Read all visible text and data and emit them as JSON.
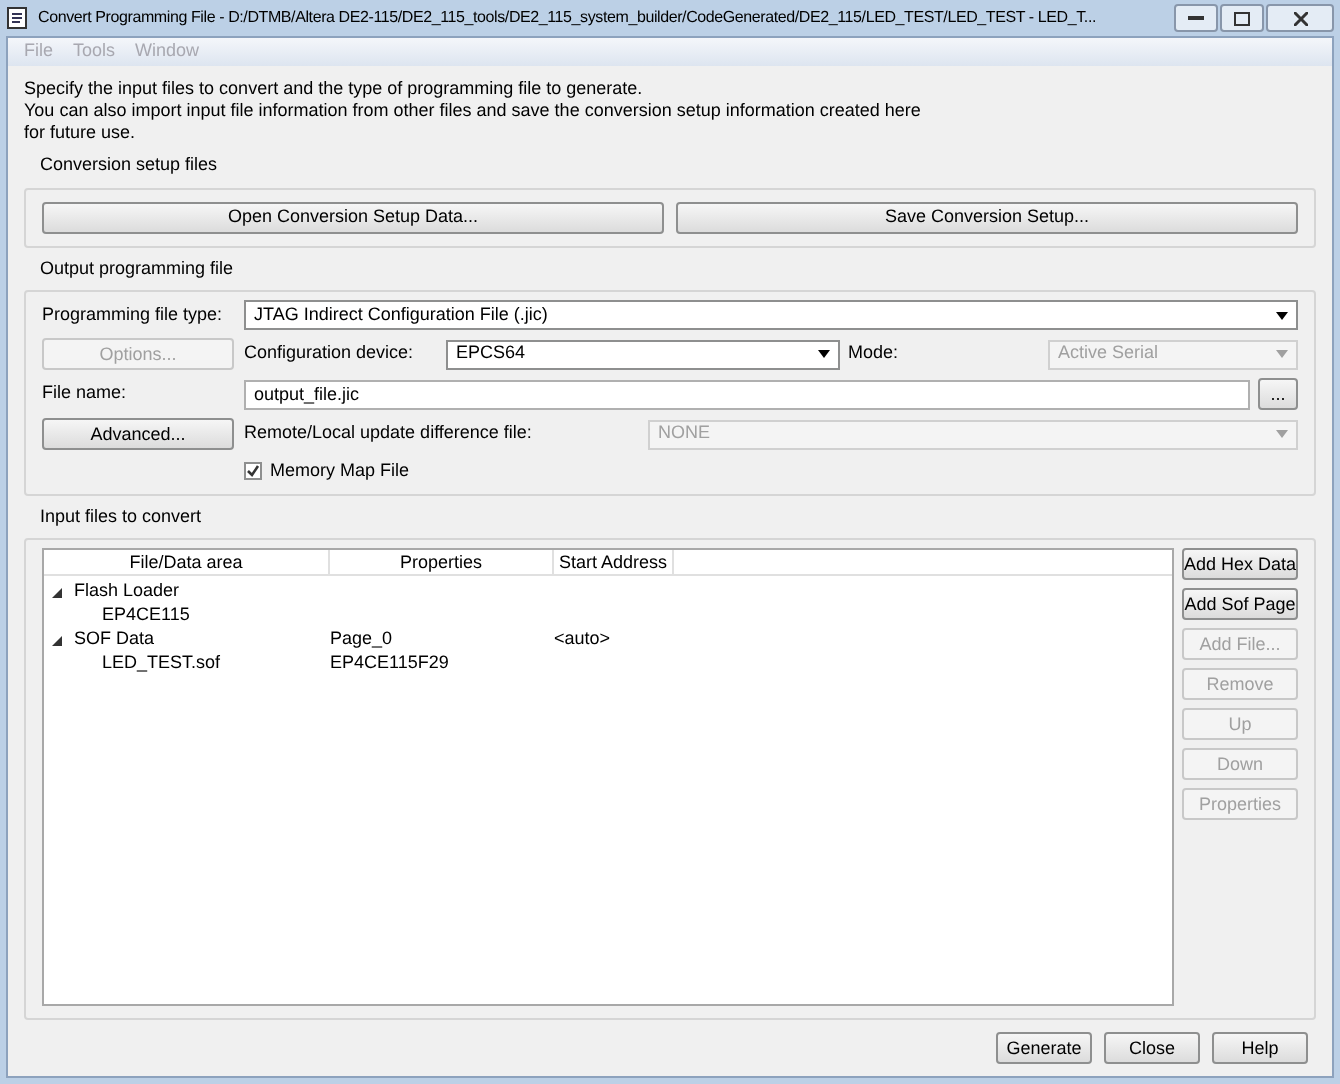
{
  "window": {
    "title": "Convert Programming File - D:/DTMB/Altera DE2-115/DE2_115_tools/DE2_115_system_builder/CodeGenerated/DE2_115/LED_TEST/LED_TEST - LED_T..."
  },
  "menu": [
    {
      "label": "File",
      "disabled": true
    },
    {
      "label": "Tools",
      "disabled": true
    },
    {
      "label": "Window",
      "disabled": true
    }
  ],
  "intro": [
    "Specify the input files to convert and the type of programming file to generate.",
    "You can also import input file information from other files and save the conversion setup information created here for future use."
  ],
  "conversion_setup": {
    "title": "Conversion setup files",
    "buttons": [
      "Open Conversion Setup Data...",
      "Save Conversion Setup..."
    ]
  },
  "output": {
    "title": "Output programming file",
    "file_type": {
      "label": "Programming file type:",
      "value": "JTAG Indirect Configuration File (.jic)"
    },
    "options_button": {
      "label": "Options...",
      "disabled": true
    },
    "device": {
      "label": "Configuration device:",
      "value": "EPCS64"
    },
    "mode": {
      "label": "Mode:",
      "value": "Active Serial",
      "disabled": true
    },
    "file_name": {
      "label": "File name:",
      "value": "output_file.jic",
      "browse": "..."
    },
    "advanced_button": {
      "label": "Advanced...",
      "disabled": false
    },
    "remote": {
      "label": "Remote/Local update difference file:",
      "value": "NONE",
      "disabled": true
    },
    "memory_map": {
      "label": "Memory Map File",
      "checked": true
    }
  },
  "input": {
    "title": "Input files to convert",
    "columns": [
      "File/Data area",
      "Properties",
      "Start Address"
    ],
    "rows": [
      {
        "name": "Flash Loader",
        "expanded": true,
        "children": [
          {
            "name": "EP4CE115"
          }
        ]
      },
      {
        "name": "SOF Data",
        "properties": "Page_0",
        "address": "<auto>",
        "expanded": true,
        "children": [
          {
            "name": "LED_TEST.sof",
            "properties": "EP4CE115F29"
          }
        ]
      }
    ],
    "buttons": [
      {
        "label": "Add Hex Data",
        "disabled": false
      },
      {
        "label": "Add Sof Page",
        "disabled": false
      },
      {
        "label": "Add File...",
        "disabled": true
      },
      {
        "label": "Remove",
        "disabled": true
      },
      {
        "label": "Up",
        "disabled": true
      },
      {
        "label": "Down",
        "disabled": true
      },
      {
        "label": "Properties",
        "disabled": true
      }
    ]
  },
  "footer_buttons": [
    "Generate",
    "Close",
    "Help"
  ]
}
